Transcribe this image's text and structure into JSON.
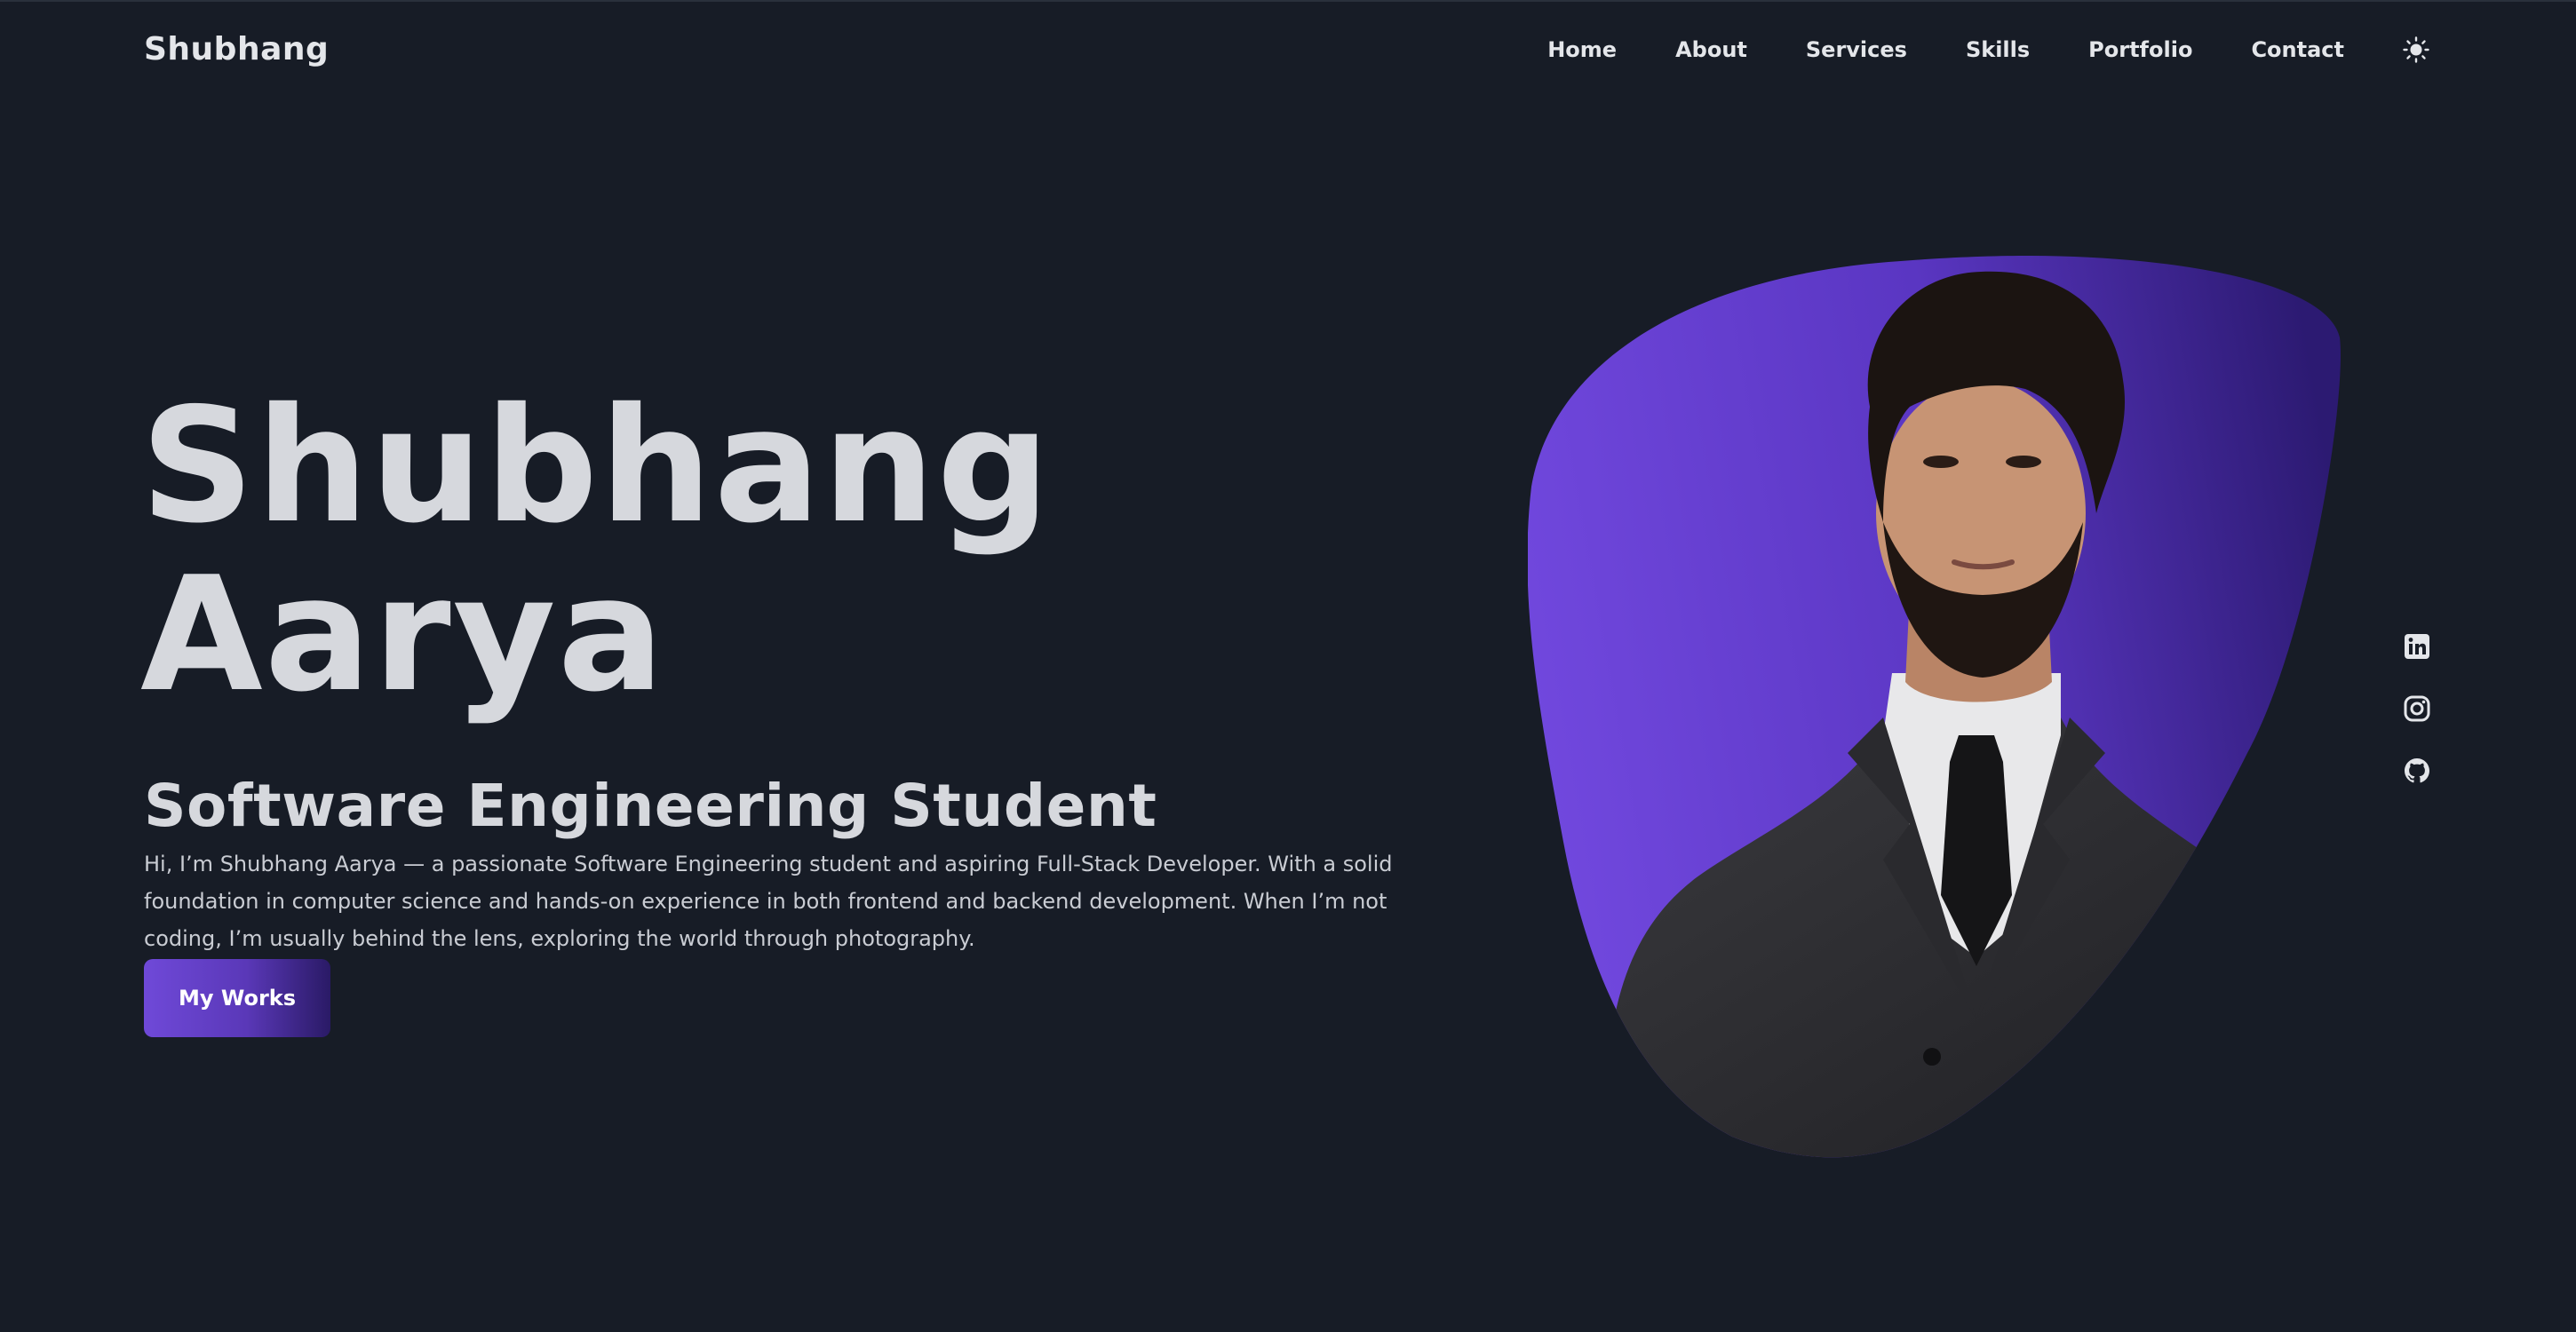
{
  "header": {
    "logo": "Shubhang",
    "nav": [
      "Home",
      "About",
      "Services",
      "Skills",
      "Portfolio",
      "Contact"
    ],
    "theme_icon": "sun-icon"
  },
  "hero": {
    "name_line1": "Shubhang",
    "name_line2": "Aarya",
    "subtitle": "Software Engineering Student",
    "description": "Hi, I’m Shubhang Aarya — a passionate Software Engineering student and aspiring Full-Stack Developer. With a solid foundation in computer science and hands-on experience in both frontend and backend development. When I’m not coding, I’m usually behind the lens, exploring the world through photography.",
    "button_label": "My Works"
  },
  "socials": [
    "linkedin-icon",
    "instagram-icon",
    "github-icon"
  ],
  "colors": {
    "background": "#171c26",
    "accent": "#6f49d8",
    "accent_dark": "#2a1a66",
    "text": "#d6d8dd"
  }
}
